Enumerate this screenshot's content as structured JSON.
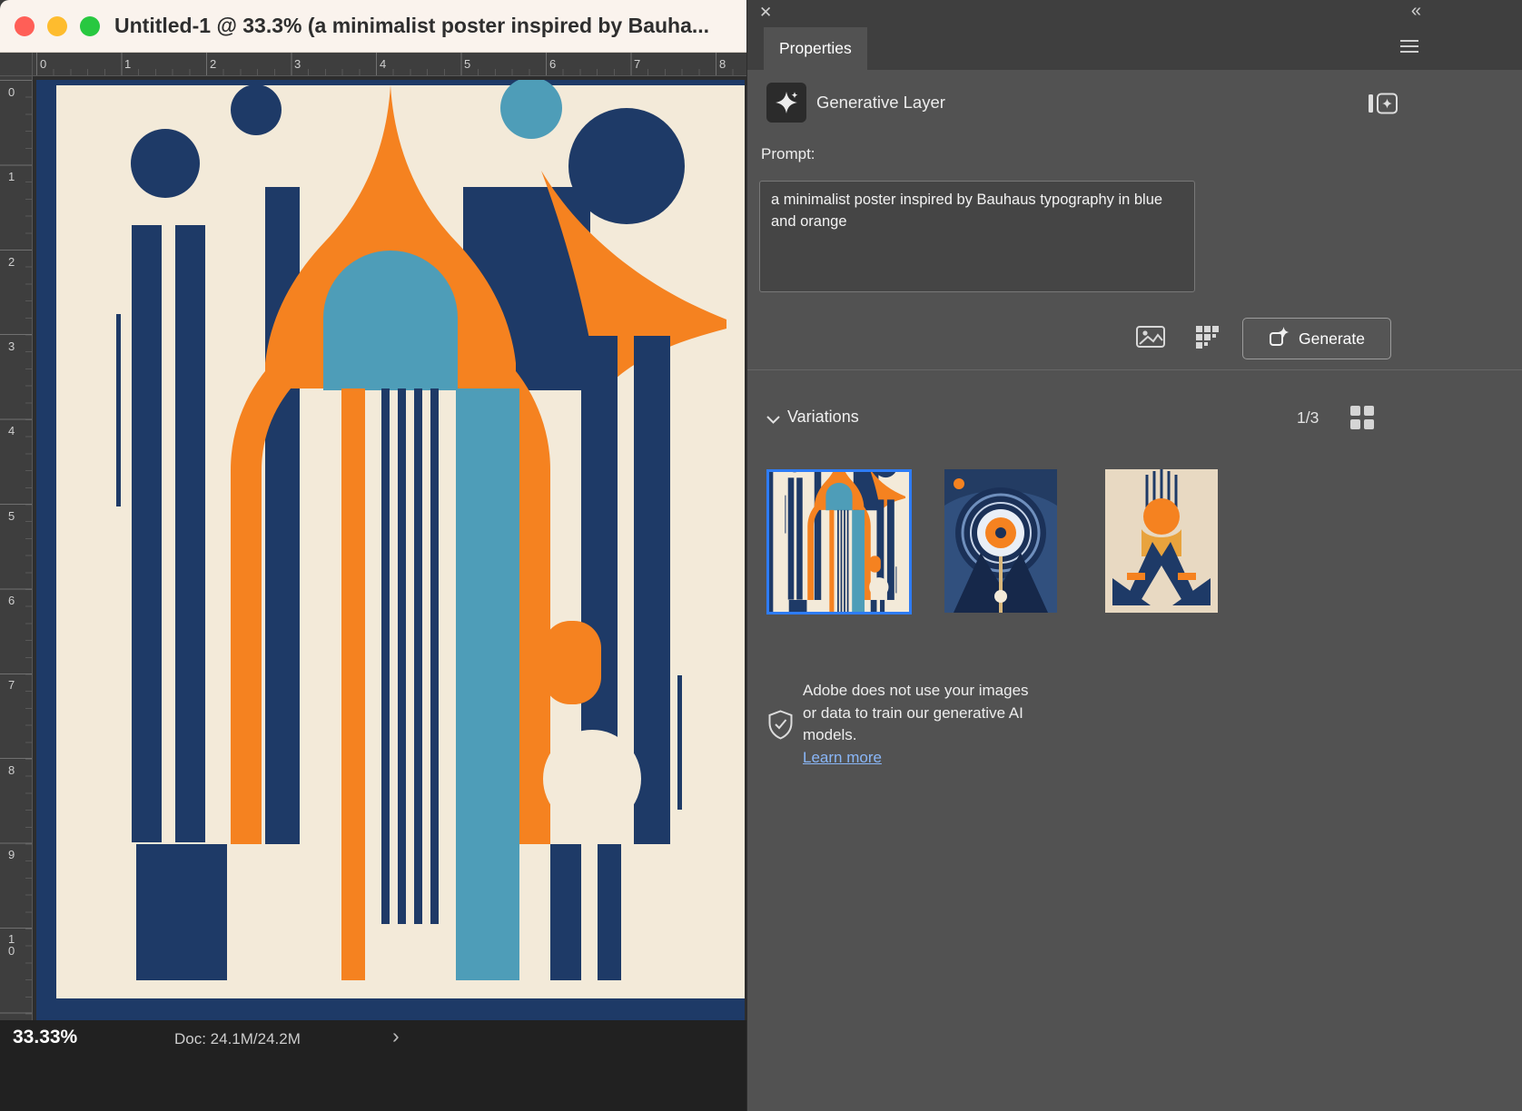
{
  "colors": {
    "navy": "#1e3a67",
    "orange": "#f58220",
    "teal": "#4e9db8",
    "cream": "#f3ead9",
    "panel_bg": "#525252",
    "selection_blue": "#2e7cf6",
    "link_blue": "#8ab7f8"
  },
  "titlebar": {
    "title": "Untitled-1 @ 33.3% (a minimalist poster inspired by Bauha..."
  },
  "rulers": {
    "horizontal": [
      "0",
      "1",
      "2",
      "3",
      "4",
      "5",
      "6",
      "7",
      "8"
    ],
    "vertical": [
      "0",
      "1",
      "2",
      "3",
      "4",
      "5",
      "6",
      "7",
      "8",
      "9",
      "10"
    ]
  },
  "statusbar": {
    "zoom": "33.33%",
    "doc": "Doc: 24.1M/24.2M",
    "chevron": "›"
  },
  "panel": {
    "close_glyph": "✕",
    "collapse_glyph": "«",
    "tab_label": "Properties",
    "layer": {
      "label": "Generative Layer"
    },
    "prompt": {
      "label": "Prompt:",
      "value": "a minimalist poster inspired by Bauhaus typography in blue and orange"
    },
    "generate_button": "Generate",
    "variations": {
      "label": "Variations",
      "counter": "1/3"
    },
    "privacy": {
      "line1": "Adobe does not use your images",
      "line2": "or data to train our generative AI",
      "line3": "models.",
      "link": "Learn more"
    }
  }
}
